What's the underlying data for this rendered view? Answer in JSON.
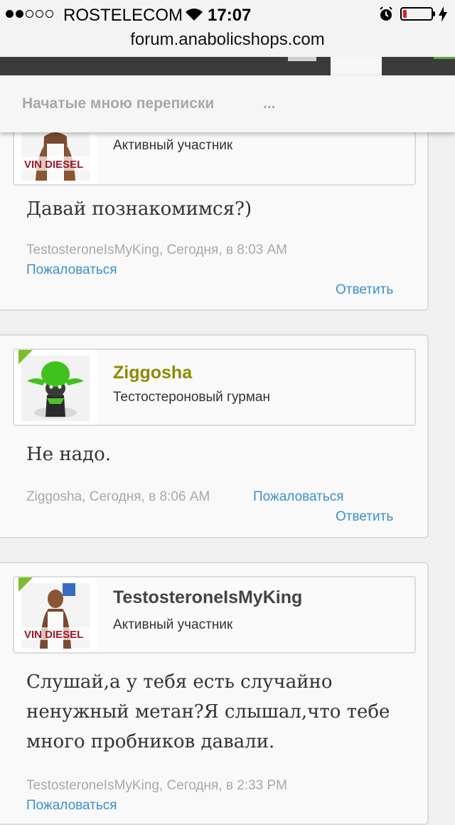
{
  "status_bar": {
    "carrier": "ROSTELECOM",
    "time": "17:07",
    "signal_strength": 2,
    "battery_level": 0.12
  },
  "browser": {
    "url": "forum.anabolicshops.com"
  },
  "submenu": {
    "started_conversations": "Начатые мною переписки",
    "more": "..."
  },
  "posts": [
    {
      "username": "",
      "user_title": "Активный участник",
      "message": "Давай познакомимся?)",
      "meta": "TestosteroneIsMyKing, Сегодня, в 8:03 AM",
      "report": "Пожаловаться",
      "reply": "Ответить"
    },
    {
      "username": "Ziggosha",
      "user_title": "Тестостероновый гурман",
      "message": "Не надо.",
      "meta": "Ziggosha, Сегодня, в 8:06 AM",
      "report": "Пожаловаться",
      "reply": "Ответить"
    },
    {
      "username": "TestosteroneIsMyKing",
      "user_title": "Активный участник",
      "message_lines": [
        "Слушай,а у тебя есть случайно",
        "ненужный метан?Я слышал,что тебе",
        "много пробников давали."
      ],
      "meta": "TestosteroneIsMyKing, Сегодня, в 2:33 PM",
      "report": "Пожаловаться"
    }
  ],
  "avatars": {
    "vin_diesel_text": "VIN DIESEL"
  }
}
